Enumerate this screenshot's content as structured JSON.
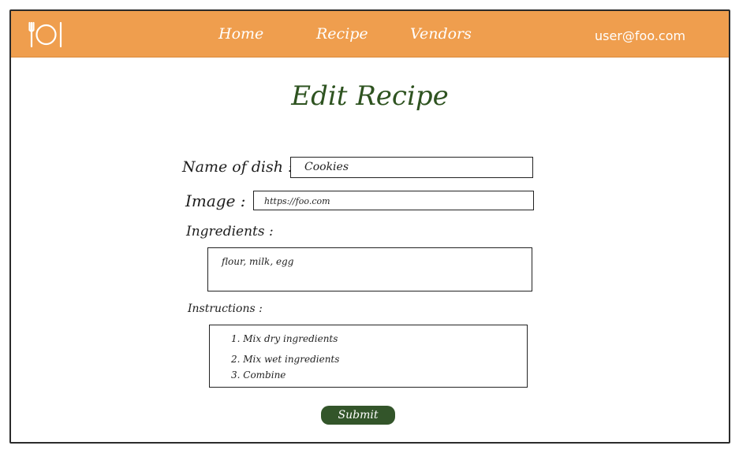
{
  "nav": {
    "home": "Home",
    "recipe": "Recipe",
    "vendors": "Vendors",
    "user": "user@foo.com"
  },
  "page": {
    "title": "Edit Recipe"
  },
  "form": {
    "name_label": "Name of dish :",
    "name_value": "Cookies",
    "image_label": "Image :",
    "image_value": "https://foo.com",
    "ingredients_label": "Ingredients :",
    "ingredients_value": "flour, milk, egg",
    "instructions_label": "Instructions :",
    "instructions": [
      "1. Mix  dry  ingredients",
      "2. Mix  wet  ingredients",
      "3. Combine"
    ],
    "submit_label": "Submit"
  },
  "colors": {
    "navbar": "#ef9e4e",
    "title": "#2e5320",
    "submit": "#33552a"
  },
  "icons": {
    "logo": "plate-utensils-icon"
  }
}
